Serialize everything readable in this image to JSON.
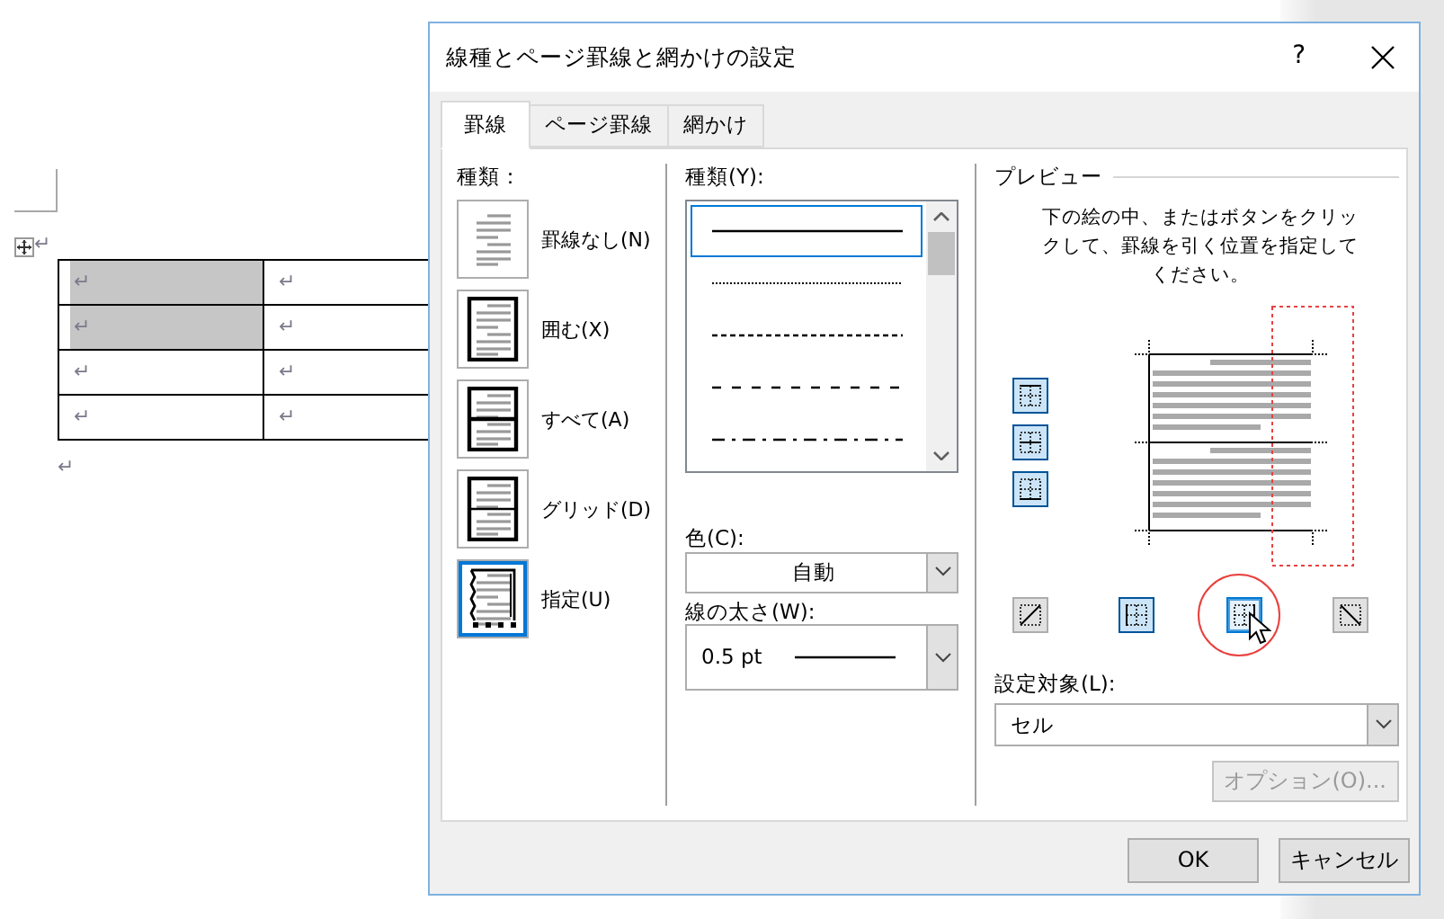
{
  "document": {
    "mark_before": "↵",
    "table": {
      "rows": [
        [
          {
            "text": "↵",
            "shaded": true
          },
          {
            "text": "↵",
            "shaded": false
          }
        ],
        [
          {
            "text": "↵",
            "shaded": true
          },
          {
            "text": "↵",
            "shaded": false
          }
        ],
        [
          {
            "text": "↵",
            "shaded": false
          },
          {
            "text": "↵",
            "shaded": false
          }
        ],
        [
          {
            "text": "↵",
            "shaded": false
          },
          {
            "text": "↵",
            "shaded": false
          }
        ]
      ]
    },
    "mark_after": "↵"
  },
  "dialog": {
    "title": "線種とページ罫線と網かけの設定",
    "help": "?",
    "tabs": [
      {
        "label": "罫線",
        "selected": true
      },
      {
        "label": "ページ罫線",
        "selected": false
      },
      {
        "label": "網かけ",
        "selected": false
      }
    ],
    "setting": {
      "label": "種類：",
      "items": [
        {
          "label": "罫線なし(N)",
          "kind": "none",
          "selected": false
        },
        {
          "label": "囲む(X)",
          "kind": "box",
          "selected": false
        },
        {
          "label": "すべて(A)",
          "kind": "all",
          "selected": false
        },
        {
          "label": "グリッド(D)",
          "kind": "grid",
          "selected": false
        },
        {
          "label": "指定(U)",
          "kind": "custom",
          "selected": true
        }
      ]
    },
    "style": {
      "label": "種類(Y):",
      "lines": [
        {
          "kind": "solid",
          "selected": true
        },
        {
          "kind": "dotted",
          "selected": false
        },
        {
          "kind": "dashed",
          "selected": false
        },
        {
          "kind": "long-dash",
          "selected": false
        },
        {
          "kind": "dash-dot",
          "selected": false
        }
      ]
    },
    "color": {
      "label": "色(C):",
      "value": "自動"
    },
    "width": {
      "label": "線の太さ(W):",
      "value": "0.5 pt"
    },
    "preview": {
      "label": "プレビュー",
      "instructions": "下の絵の中、またはボタンをクリックして、罫線を引く位置を指定してください。",
      "side_buttons": [
        {
          "kind": "top",
          "selected": true
        },
        {
          "kind": "inside-horizontal",
          "selected": true
        },
        {
          "kind": "bottom",
          "selected": true
        }
      ],
      "bottom_buttons": [
        {
          "kind": "diagonal-up",
          "selected": false,
          "hovered": false
        },
        {
          "kind": "left",
          "selected": true,
          "hovered": false
        },
        {
          "kind": "right",
          "selected": false,
          "hovered": true
        },
        {
          "kind": "diagonal-down",
          "selected": false,
          "hovered": false
        }
      ]
    },
    "apply_to": {
      "label": "設定対象(L):",
      "value": "セル"
    },
    "options_button": {
      "label": "オプション(O)...",
      "disabled": true
    },
    "buttons": [
      {
        "label": "OK"
      },
      {
        "label": "キャンセル"
      }
    ]
  }
}
